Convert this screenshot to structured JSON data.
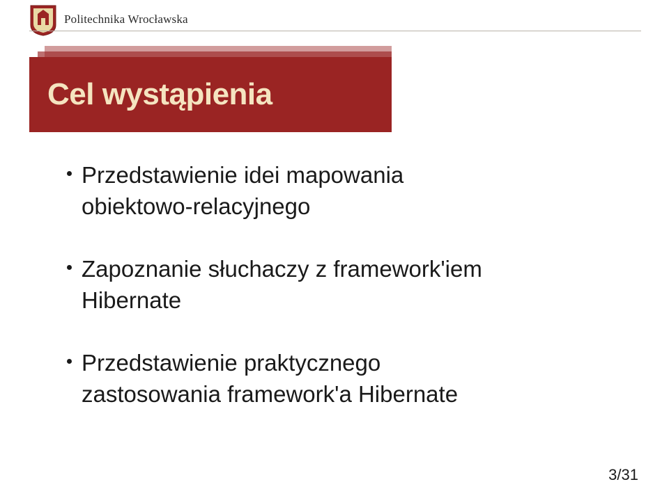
{
  "header": {
    "university": "Politechnika Wrocławska"
  },
  "title": "Cel wystąpienia",
  "bullets": [
    {
      "line1": "Przedstawienie idei mapowania",
      "line2": "obiektowo-relacyjnego"
    },
    {
      "line1": "Zapoznanie słuchaczy z framework'iem",
      "line2": "Hibernate"
    },
    {
      "line1": "Przedstawienie praktycznego",
      "line2": "zastosowania framework'a Hibernate"
    }
  ],
  "page": {
    "current": 3,
    "total": 31,
    "display": "3/31"
  }
}
